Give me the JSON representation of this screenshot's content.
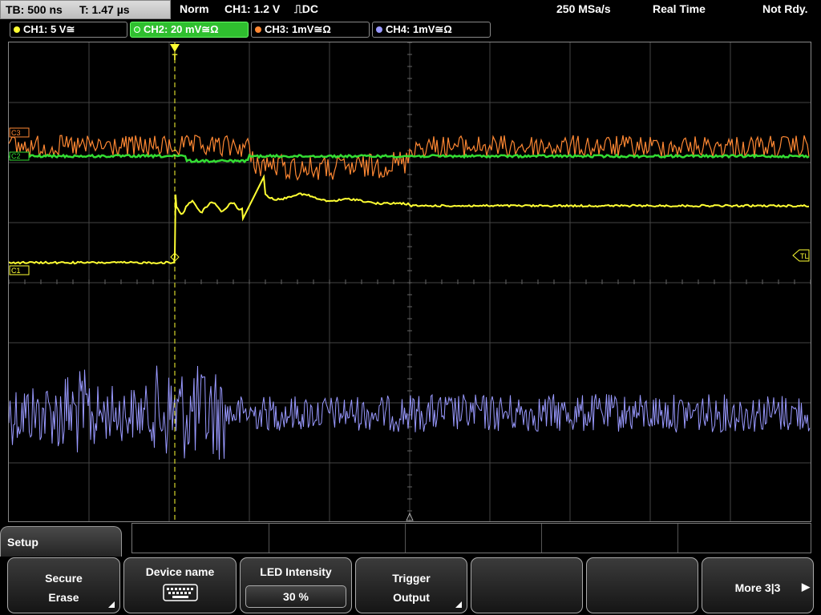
{
  "status": {
    "timebase": "TB: 500 ns",
    "trigger_time": "T: 1.47 µs",
    "mode": "Norm",
    "trigger_info": "CH1: 1.2 V",
    "trigger_edge_coupling": "⎍DC",
    "sample_rate": "250 MSa/s",
    "acq_mode": "Real Time",
    "ready_state": "Not Rdy."
  },
  "channels": [
    {
      "label": "CH1: 5 V",
      "coupling": "≅",
      "color": "#ffff33",
      "active": false
    },
    {
      "label": "CH2: 20 mV",
      "coupling": "≅Ω",
      "color": "#33dd33",
      "active": true
    },
    {
      "label": "CH3: 1mV",
      "coupling": "≅Ω",
      "color": "#ff8833",
      "active": false
    },
    {
      "label": "CH4: 1mV",
      "coupling": "≅Ω",
      "color": "#9999ff",
      "active": false
    }
  ],
  "markers": {
    "c3": "C3",
    "c2": "C2",
    "c1": "C1",
    "trigger_level": "TL",
    "trigger_pos": "T"
  },
  "menu": {
    "title": "Setup",
    "softkeys": [
      {
        "line1": "Secure",
        "line2": "Erase",
        "has_submenu": true
      },
      {
        "line1": "Device name",
        "icon": "keyboard-icon"
      },
      {
        "line1": "LED Intensity",
        "value": "30 %"
      },
      {
        "line1": "Trigger",
        "line2": "Output",
        "has_submenu": true
      },
      {
        "line1": ""
      },
      {
        "line1": ""
      },
      {
        "line1": "More 3|3",
        "arrow": "▶"
      }
    ]
  },
  "colors": {
    "ch1": "#ffff33",
    "ch2": "#33dd33",
    "ch3": "#ff8833",
    "ch4": "#9999ff",
    "grid": "#444444"
  }
}
